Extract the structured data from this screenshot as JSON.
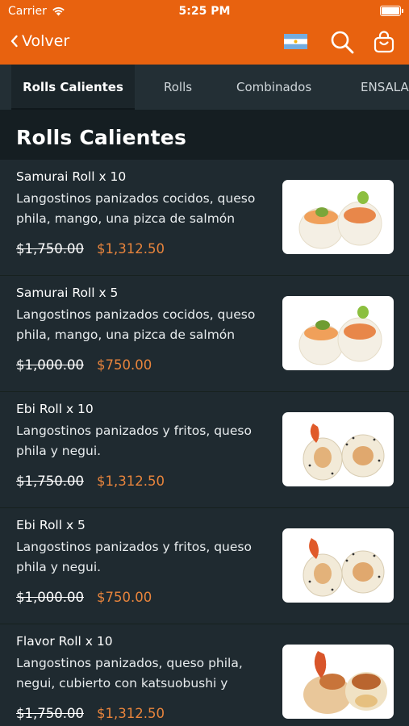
{
  "status_bar": {
    "carrier": "Carrier",
    "time": "5:25 PM"
  },
  "nav": {
    "back_label": "Volver",
    "flag_icon": "argentina-flag-icon",
    "search_icon": "search-icon",
    "cart_icon": "shopping-bag-icon"
  },
  "tabs": [
    {
      "label": "Rolls Calientes",
      "active": true
    },
    {
      "label": "Rolls",
      "active": false
    },
    {
      "label": "Combinados",
      "active": false
    },
    {
      "label": "ENSALADAS",
      "active": false
    }
  ],
  "section": {
    "title": "Rolls Calientes"
  },
  "items": [
    {
      "name": "Samurai Roll x 10",
      "description": "Langostinos panizados cocidos, queso phila, mango, una pizca de salmón",
      "price_old": "$1,750.00",
      "price_new": "$1,312.50",
      "image": "samurai-roll-photo"
    },
    {
      "name": "Samurai Roll x 5",
      "description": "Langostinos panizados cocidos, queso phila, mango, una pizca de salmón",
      "price_old": "$1,000.00",
      "price_new": "$750.00",
      "image": "samurai-roll-photo"
    },
    {
      "name": "Ebi Roll x 10",
      "description": "Langostinos panizados y fritos, queso phila y negui.",
      "price_old": "$1,750.00",
      "price_new": "$1,312.50",
      "image": "ebi-roll-photo"
    },
    {
      "name": "Ebi Roll x 5",
      "description": "Langostinos panizados y fritos, queso phila y negui.",
      "price_old": "$1,000.00",
      "price_new": "$750.00",
      "image": "ebi-roll-photo"
    },
    {
      "name": "Flavor Roll x 10",
      "description": "Langostinos panizados, queso phila, negui, cubierto con katsuobushi y",
      "price_old": "$1,750.00",
      "price_new": "$1,312.50",
      "image": "flavor-roll-photo"
    }
  ],
  "colors": {
    "header": "#e8620f",
    "background": "#1f2a30",
    "price_accent": "#e8843c"
  }
}
